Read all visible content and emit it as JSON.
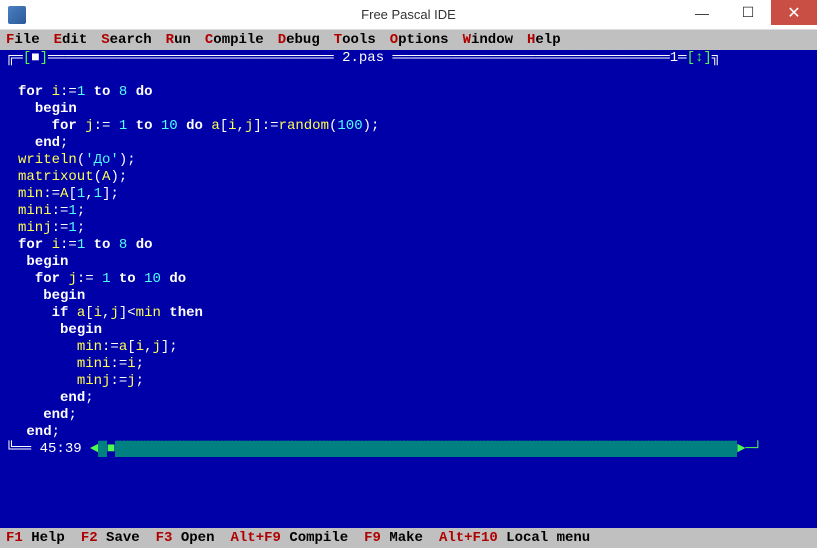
{
  "window": {
    "title": "Free Pascal IDE"
  },
  "menu": {
    "file": {
      "hot": "F",
      "rest": "ile"
    },
    "edit": {
      "hot": "E",
      "rest": "dit"
    },
    "search": {
      "hot": "S",
      "rest": "earch"
    },
    "run": {
      "hot": "R",
      "rest": "un"
    },
    "compile": {
      "hot": "C",
      "rest": "ompile"
    },
    "debug": {
      "hot": "D",
      "rest": "ebug"
    },
    "tools": {
      "hot": "T",
      "rest": "ools"
    },
    "options": {
      "hot": "O",
      "rest": "ptions"
    },
    "window": {
      "hot": "W",
      "rest": "indow"
    },
    "help": {
      "hot": "H",
      "rest": "elp"
    }
  },
  "editor": {
    "filename": "2.pas",
    "window_number": "1",
    "cursor": "45:39",
    "code": {
      "l1": {
        "kw1": "for",
        "id1": "i",
        "sym1": ":=",
        "n1": "1",
        "kw2": "to",
        "n2": "8",
        "kw3": "do"
      },
      "l2": {
        "kw": "begin"
      },
      "l3": {
        "kw1": "for",
        "id1": "j",
        "sym1": ":=",
        "n1": "1",
        "kw2": "to",
        "n2": "10",
        "kw3": "do",
        "id2": "a",
        "sym2": "[",
        "id3": "i",
        "sym3": ",",
        "id4": "j",
        "sym4": "]:=",
        "id5": "random",
        "sym5": "(",
        "n3": "100",
        "sym6": ");"
      },
      "l4": {
        "kw": "end",
        "sym": ";"
      },
      "l5": {
        "id": "writeln",
        "sym1": "(",
        "str": "'До'",
        "sym2": ");"
      },
      "l6": {
        "id": "matrixout",
        "sym1": "(",
        "id2": "A",
        "sym2": ");"
      },
      "l7": {
        "id": "min",
        "sym1": ":=",
        "id2": "A",
        "sym2": "[",
        "n1": "1",
        "sym3": ",",
        "n2": "1",
        "sym4": "];"
      },
      "l8": {
        "id": "mini",
        "sym": ":=",
        "n": "1",
        "sym2": ";"
      },
      "l9": {
        "id": "minj",
        "sym": ":=",
        "n": "1",
        "sym2": ";"
      },
      "l10": {
        "kw1": "for",
        "id1": "i",
        "sym1": ":=",
        "n1": "1",
        "kw2": "to",
        "n2": "8",
        "kw3": "do"
      },
      "l11": {
        "kw": "begin"
      },
      "l12": {
        "kw1": "for",
        "id1": "j",
        "sym1": ":=",
        "n1": "1",
        "kw2": "to",
        "n2": "10",
        "kw3": "do"
      },
      "l13": {
        "kw": "begin"
      },
      "l14": {
        "kw1": "if",
        "id1": "a",
        "sym1": "[",
        "id2": "i",
        "sym2": ",",
        "id3": "j",
        "sym3": "]<",
        "id4": "min",
        "kw2": "then"
      },
      "l15": {
        "kw": "begin"
      },
      "l16": {
        "id1": "min",
        "sym1": ":=",
        "id2": "a",
        "sym2": "[",
        "id3": "i",
        "sym3": ",",
        "id4": "j",
        "sym4": "];"
      },
      "l17": {
        "id1": "mini",
        "sym1": ":=",
        "id2": "i",
        "sym2": ";"
      },
      "l18": {
        "id1": "minj",
        "sym1": ":=",
        "id2": "j",
        "sym2": ";"
      },
      "l19": {
        "kw": "end",
        "sym": ";"
      },
      "l20": {
        "kw": "end",
        "sym": ";"
      },
      "l21": {
        "kw": "end",
        "sym": ";"
      }
    }
  },
  "status": {
    "f1": {
      "key": "F1",
      "label": "Help"
    },
    "f2": {
      "key": "F2",
      "label": "Save"
    },
    "f3": {
      "key": "F3",
      "label": "Open"
    },
    "altf9": {
      "key": "Alt+F9",
      "label": "Compile"
    },
    "f9": {
      "key": "F9",
      "label": "Make"
    },
    "altf10": {
      "key": "Alt+F10",
      "label": "Local menu"
    }
  }
}
